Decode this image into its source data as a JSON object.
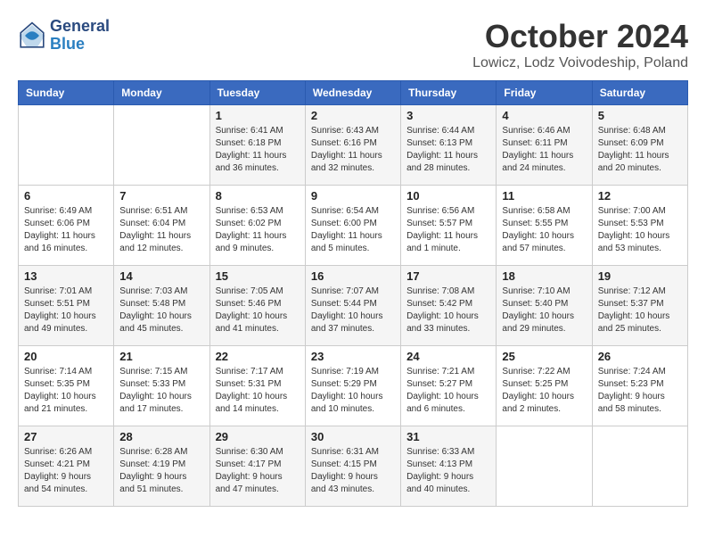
{
  "header": {
    "logo_line1": "General",
    "logo_line2": "Blue",
    "month": "October 2024",
    "location": "Lowicz, Lodz Voivodeship, Poland"
  },
  "days_of_week": [
    "Sunday",
    "Monday",
    "Tuesday",
    "Wednesday",
    "Thursday",
    "Friday",
    "Saturday"
  ],
  "weeks": [
    [
      {
        "day": "",
        "info": ""
      },
      {
        "day": "",
        "info": ""
      },
      {
        "day": "1",
        "info": "Sunrise: 6:41 AM\nSunset: 6:18 PM\nDaylight: 11 hours and 36 minutes."
      },
      {
        "day": "2",
        "info": "Sunrise: 6:43 AM\nSunset: 6:16 PM\nDaylight: 11 hours and 32 minutes."
      },
      {
        "day": "3",
        "info": "Sunrise: 6:44 AM\nSunset: 6:13 PM\nDaylight: 11 hours and 28 minutes."
      },
      {
        "day": "4",
        "info": "Sunrise: 6:46 AM\nSunset: 6:11 PM\nDaylight: 11 hours and 24 minutes."
      },
      {
        "day": "5",
        "info": "Sunrise: 6:48 AM\nSunset: 6:09 PM\nDaylight: 11 hours and 20 minutes."
      }
    ],
    [
      {
        "day": "6",
        "info": "Sunrise: 6:49 AM\nSunset: 6:06 PM\nDaylight: 11 hours and 16 minutes."
      },
      {
        "day": "7",
        "info": "Sunrise: 6:51 AM\nSunset: 6:04 PM\nDaylight: 11 hours and 12 minutes."
      },
      {
        "day": "8",
        "info": "Sunrise: 6:53 AM\nSunset: 6:02 PM\nDaylight: 11 hours and 9 minutes."
      },
      {
        "day": "9",
        "info": "Sunrise: 6:54 AM\nSunset: 6:00 PM\nDaylight: 11 hours and 5 minutes."
      },
      {
        "day": "10",
        "info": "Sunrise: 6:56 AM\nSunset: 5:57 PM\nDaylight: 11 hours and 1 minute."
      },
      {
        "day": "11",
        "info": "Sunrise: 6:58 AM\nSunset: 5:55 PM\nDaylight: 10 hours and 57 minutes."
      },
      {
        "day": "12",
        "info": "Sunrise: 7:00 AM\nSunset: 5:53 PM\nDaylight: 10 hours and 53 minutes."
      }
    ],
    [
      {
        "day": "13",
        "info": "Sunrise: 7:01 AM\nSunset: 5:51 PM\nDaylight: 10 hours and 49 minutes."
      },
      {
        "day": "14",
        "info": "Sunrise: 7:03 AM\nSunset: 5:48 PM\nDaylight: 10 hours and 45 minutes."
      },
      {
        "day": "15",
        "info": "Sunrise: 7:05 AM\nSunset: 5:46 PM\nDaylight: 10 hours and 41 minutes."
      },
      {
        "day": "16",
        "info": "Sunrise: 7:07 AM\nSunset: 5:44 PM\nDaylight: 10 hours and 37 minutes."
      },
      {
        "day": "17",
        "info": "Sunrise: 7:08 AM\nSunset: 5:42 PM\nDaylight: 10 hours and 33 minutes."
      },
      {
        "day": "18",
        "info": "Sunrise: 7:10 AM\nSunset: 5:40 PM\nDaylight: 10 hours and 29 minutes."
      },
      {
        "day": "19",
        "info": "Sunrise: 7:12 AM\nSunset: 5:37 PM\nDaylight: 10 hours and 25 minutes."
      }
    ],
    [
      {
        "day": "20",
        "info": "Sunrise: 7:14 AM\nSunset: 5:35 PM\nDaylight: 10 hours and 21 minutes."
      },
      {
        "day": "21",
        "info": "Sunrise: 7:15 AM\nSunset: 5:33 PM\nDaylight: 10 hours and 17 minutes."
      },
      {
        "day": "22",
        "info": "Sunrise: 7:17 AM\nSunset: 5:31 PM\nDaylight: 10 hours and 14 minutes."
      },
      {
        "day": "23",
        "info": "Sunrise: 7:19 AM\nSunset: 5:29 PM\nDaylight: 10 hours and 10 minutes."
      },
      {
        "day": "24",
        "info": "Sunrise: 7:21 AM\nSunset: 5:27 PM\nDaylight: 10 hours and 6 minutes."
      },
      {
        "day": "25",
        "info": "Sunrise: 7:22 AM\nSunset: 5:25 PM\nDaylight: 10 hours and 2 minutes."
      },
      {
        "day": "26",
        "info": "Sunrise: 7:24 AM\nSunset: 5:23 PM\nDaylight: 9 hours and 58 minutes."
      }
    ],
    [
      {
        "day": "27",
        "info": "Sunrise: 6:26 AM\nSunset: 4:21 PM\nDaylight: 9 hours and 54 minutes."
      },
      {
        "day": "28",
        "info": "Sunrise: 6:28 AM\nSunset: 4:19 PM\nDaylight: 9 hours and 51 minutes."
      },
      {
        "day": "29",
        "info": "Sunrise: 6:30 AM\nSunset: 4:17 PM\nDaylight: 9 hours and 47 minutes."
      },
      {
        "day": "30",
        "info": "Sunrise: 6:31 AM\nSunset: 4:15 PM\nDaylight: 9 hours and 43 minutes."
      },
      {
        "day": "31",
        "info": "Sunrise: 6:33 AM\nSunset: 4:13 PM\nDaylight: 9 hours and 40 minutes."
      },
      {
        "day": "",
        "info": ""
      },
      {
        "day": "",
        "info": ""
      }
    ]
  ]
}
